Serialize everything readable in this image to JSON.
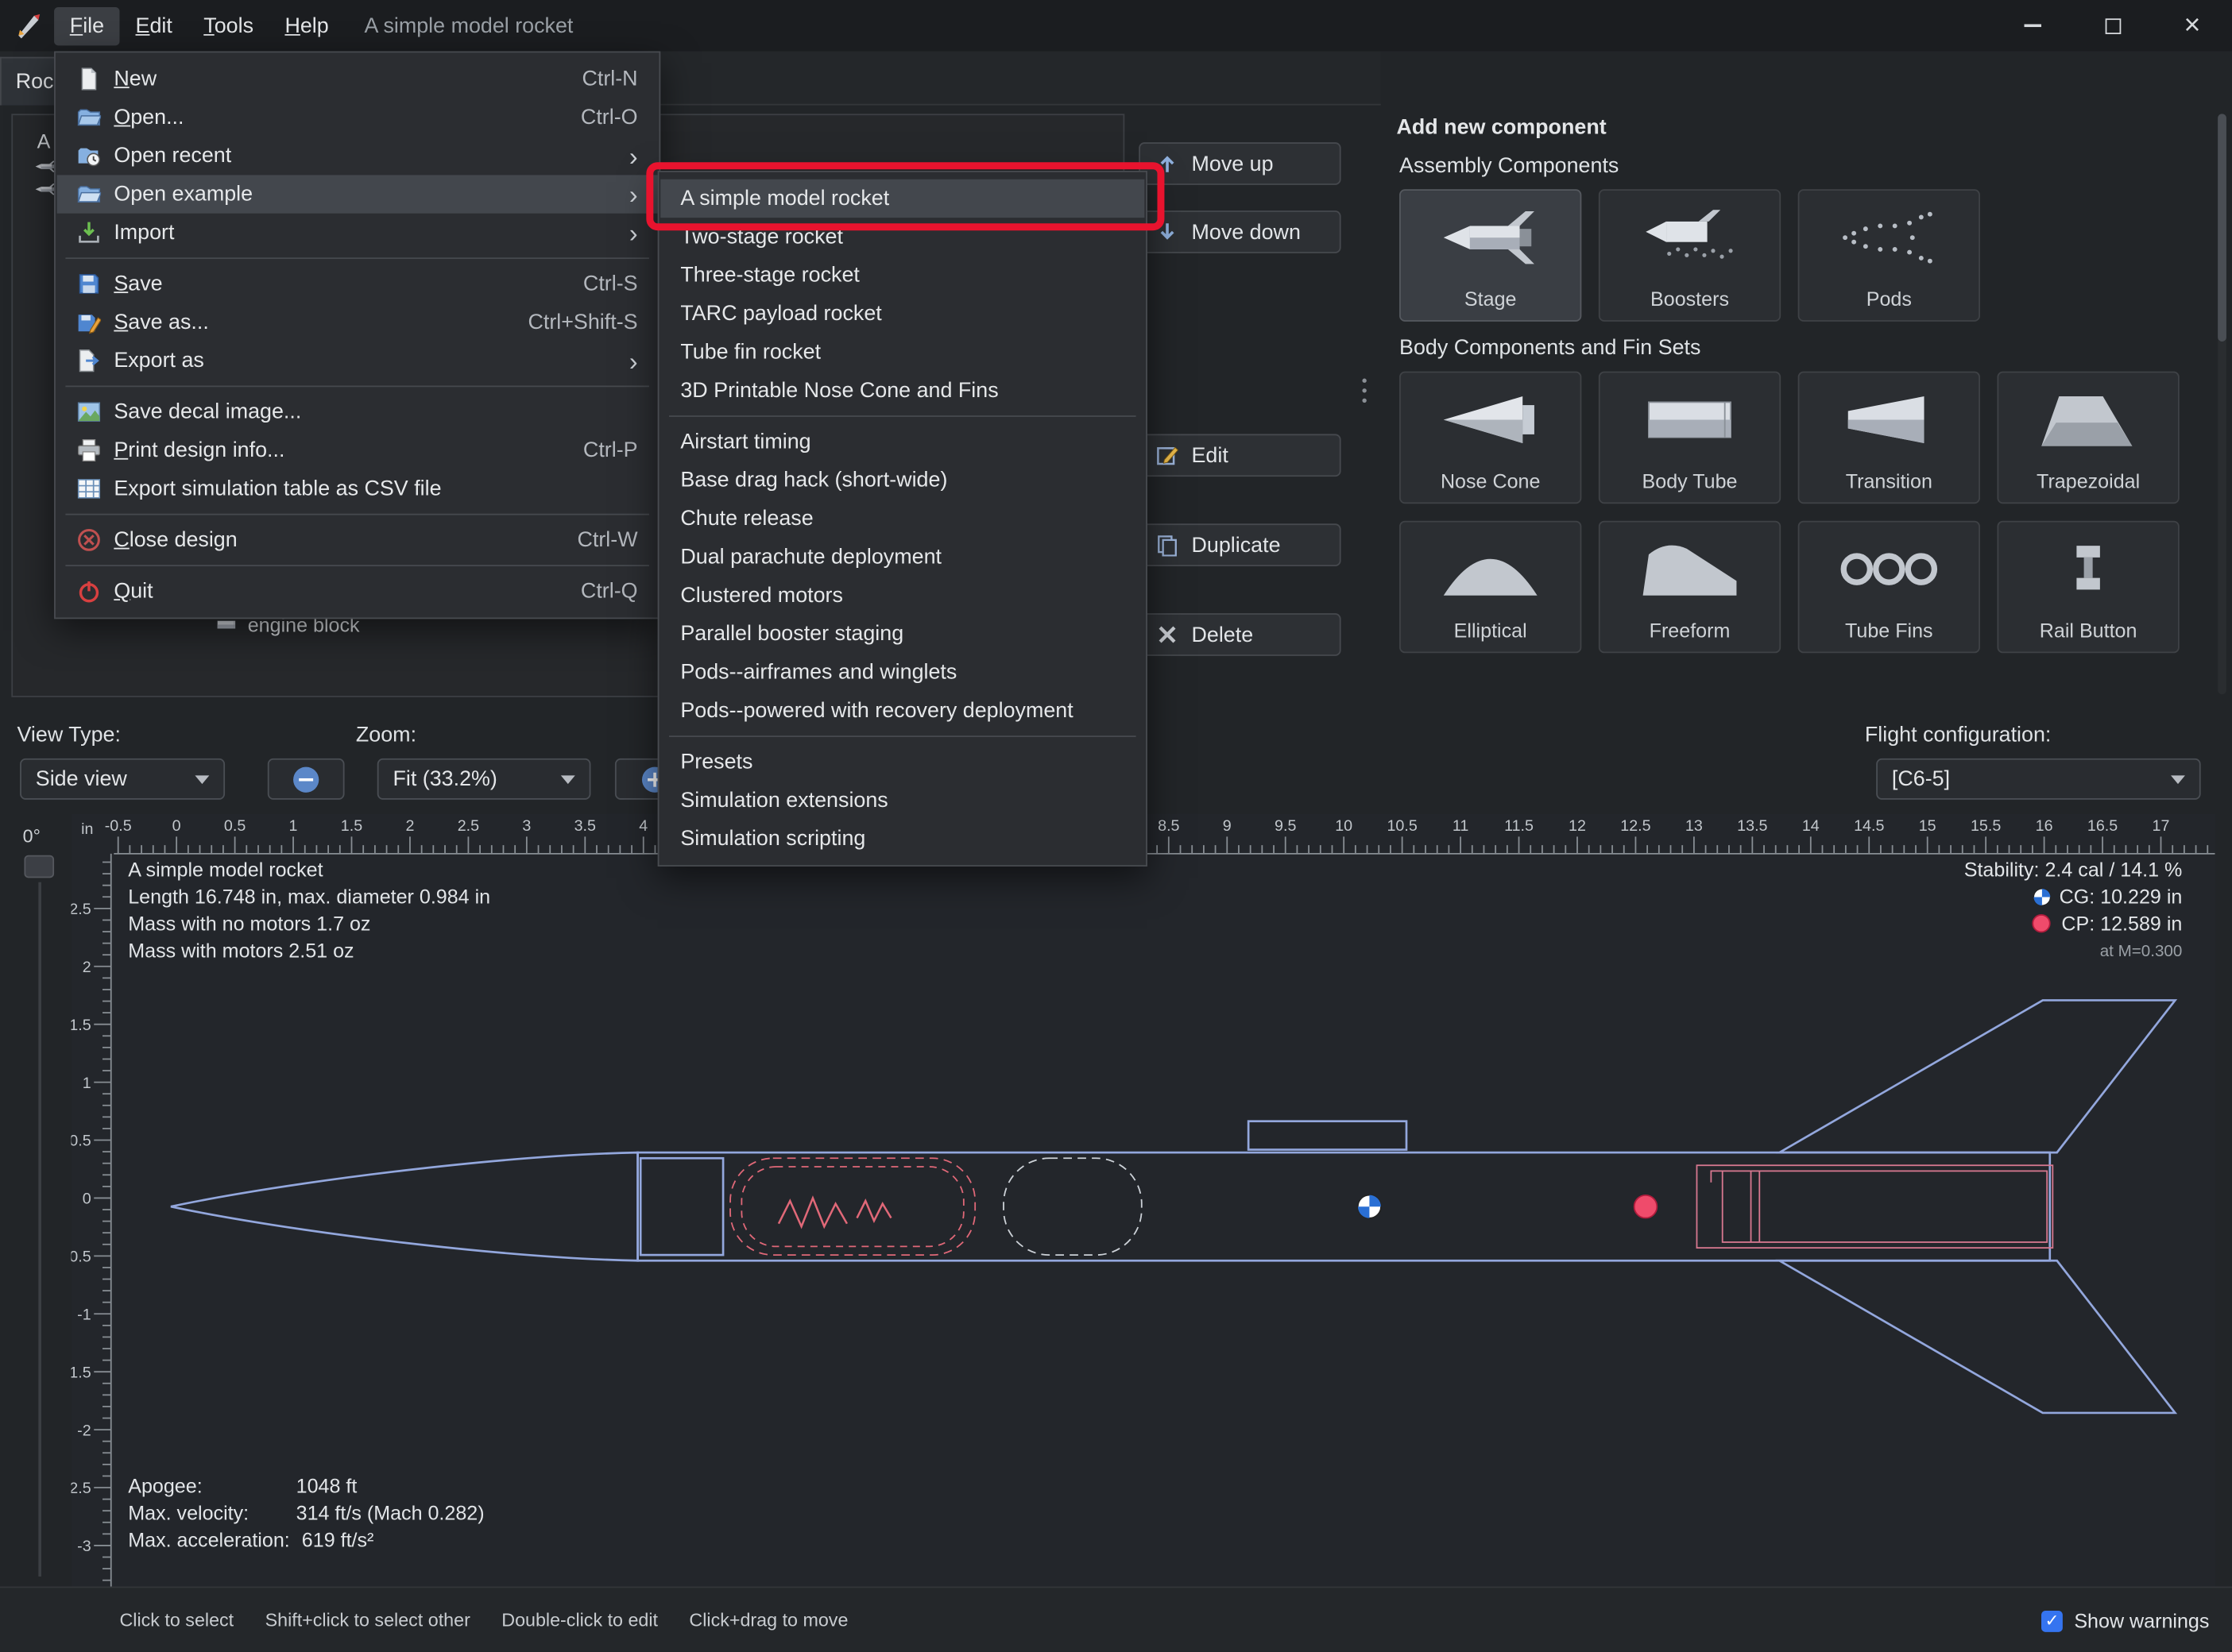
{
  "titlebar": {
    "menus": [
      "File",
      "Edit",
      "Tools",
      "Help"
    ],
    "title": "A simple model rocket"
  },
  "tab": {
    "label": "Rock"
  },
  "tree": {
    "root_fragment": "A si",
    "item_fragment": "engine block"
  },
  "file_menu": {
    "items": [
      {
        "label": "New",
        "shortcut": "Ctrl-N",
        "icon": "new",
        "u": 0
      },
      {
        "label": "Open...",
        "shortcut": "Ctrl-O",
        "icon": "open",
        "u": 0
      },
      {
        "label": "Open recent",
        "icon": "recent",
        "arrow": true
      },
      {
        "label": "Open example",
        "icon": "example",
        "arrow": true,
        "selected": true
      },
      {
        "label": "Import",
        "icon": "import",
        "arrow": true
      },
      {
        "sep": true
      },
      {
        "label": "Save",
        "shortcut": "Ctrl-S",
        "icon": "save",
        "u": 0
      },
      {
        "label": "Save as...",
        "shortcut": "Ctrl+Shift-S",
        "icon": "saveas",
        "u": 0
      },
      {
        "label": "Export as",
        "icon": "export",
        "arrow": true
      },
      {
        "sep": true
      },
      {
        "label": "Save decal image...",
        "icon": "decal"
      },
      {
        "label": "Print design info...",
        "shortcut": "Ctrl-P",
        "icon": "print",
        "u": 0
      },
      {
        "label": "Export simulation table as CSV file",
        "icon": "csv"
      },
      {
        "sep": true
      },
      {
        "label": "Close design",
        "shortcut": "Ctrl-W",
        "icon": "close",
        "u": 0
      },
      {
        "sep": true
      },
      {
        "label": "Quit",
        "shortcut": "Ctrl-Q",
        "icon": "quit",
        "u": 0
      }
    ]
  },
  "example_menu": {
    "items": [
      {
        "label": "A simple model rocket",
        "selected": true
      },
      {
        "label": "Two-stage rocket"
      },
      {
        "label": "Three-stage rocket"
      },
      {
        "label": "TARC payload rocket"
      },
      {
        "label": "Tube fin rocket"
      },
      {
        "label": "3D Printable Nose Cone and Fins"
      },
      {
        "sep": true
      },
      {
        "label": "Airstart timing"
      },
      {
        "label": "Base drag hack (short-wide)"
      },
      {
        "label": "Chute release"
      },
      {
        "label": "Dual parachute deployment"
      },
      {
        "label": "Clustered motors"
      },
      {
        "label": "Parallel booster staging"
      },
      {
        "label": "Pods--airframes and winglets"
      },
      {
        "label": "Pods--powered with recovery deployment"
      },
      {
        "sep": true
      },
      {
        "label": "Presets"
      },
      {
        "label": "Simulation extensions"
      },
      {
        "label": "Simulation scripting"
      }
    ]
  },
  "action_buttons": [
    {
      "label": "Move up",
      "icon": "arrow-up"
    },
    {
      "label": "Move down",
      "icon": "arrow-down"
    },
    {
      "label": "Edit",
      "icon": "edit"
    },
    {
      "label": "Duplicate",
      "icon": "duplicate"
    },
    {
      "label": "Delete",
      "icon": "delete"
    }
  ],
  "add_component": {
    "title": "Add new component",
    "sections": [
      {
        "label": "Assembly Components",
        "items": [
          {
            "label": "Stage",
            "icon": "stage",
            "selected": true
          },
          {
            "label": "Boosters",
            "icon": "boosters"
          },
          {
            "label": "Pods",
            "icon": "pods"
          }
        ]
      },
      {
        "label": "Body Components and Fin Sets",
        "items": [
          {
            "label": "Nose Cone",
            "icon": "nosecone"
          },
          {
            "label": "Body Tube",
            "icon": "bodytube"
          },
          {
            "label": "Transition",
            "icon": "transition"
          },
          {
            "label": "Trapezoidal",
            "icon": "trapezoidal"
          },
          {
            "label": "Elliptical",
            "icon": "elliptical"
          },
          {
            "label": "Freeform",
            "icon": "freeform"
          },
          {
            "label": "Tube Fins",
            "icon": "tubefins"
          },
          {
            "label": "Rail Button",
            "icon": "railbutton"
          }
        ]
      }
    ]
  },
  "view_controls": {
    "view_type_label": "View Type:",
    "view_type_value": "Side view",
    "zoom_label": "Zoom:",
    "zoom_value": "Fit (33.2%)",
    "flight_config_label": "Flight configuration:",
    "flight_config_value": "[C6-5]"
  },
  "canvas": {
    "unit": "in",
    "rotation": "0°",
    "info": {
      "title": "A simple model rocket",
      "length": "Length 16.748 in, max. diameter 0.984 in",
      "mass_no_motors": "Mass with no motors 1.7 oz",
      "mass_with_motors": "Mass with motors 2.51 oz"
    },
    "stability": {
      "stability": "Stability: 2.4 cal / 14.1 %",
      "cg": "CG: 10.229 in",
      "cp": "CP: 12.589 in",
      "mach": "at M=0.300"
    },
    "performance": {
      "apogee_label": "Apogee:",
      "apogee_value": "1048 ft",
      "velocity_label": "Max. velocity:",
      "velocity_value": "314 ft/s  (Mach 0.282)",
      "acceleration_label": "Max. acceleration:",
      "acceleration_value": "619 ft/s²"
    },
    "h_ruler": {
      "min": -0.5,
      "max": 17,
      "label_step": 0.5
    },
    "v_ruler": {
      "min": -3,
      "max": 2.5,
      "label_step": 0.5
    }
  },
  "statusbar": {
    "hints": [
      "Click to select",
      "Shift+click to select other",
      "Double-click to edit",
      "Click+drag to move"
    ],
    "show_warnings": "Show warnings",
    "warnings_checked": true,
    "check_glyph": "✓"
  },
  "colors": {
    "annotation": "#e8132e",
    "rocket_outline": "#93a7dd",
    "component_red": "#e06878",
    "cg_blue": "#2a6fd4",
    "cp_red": "#ef4b6b"
  }
}
